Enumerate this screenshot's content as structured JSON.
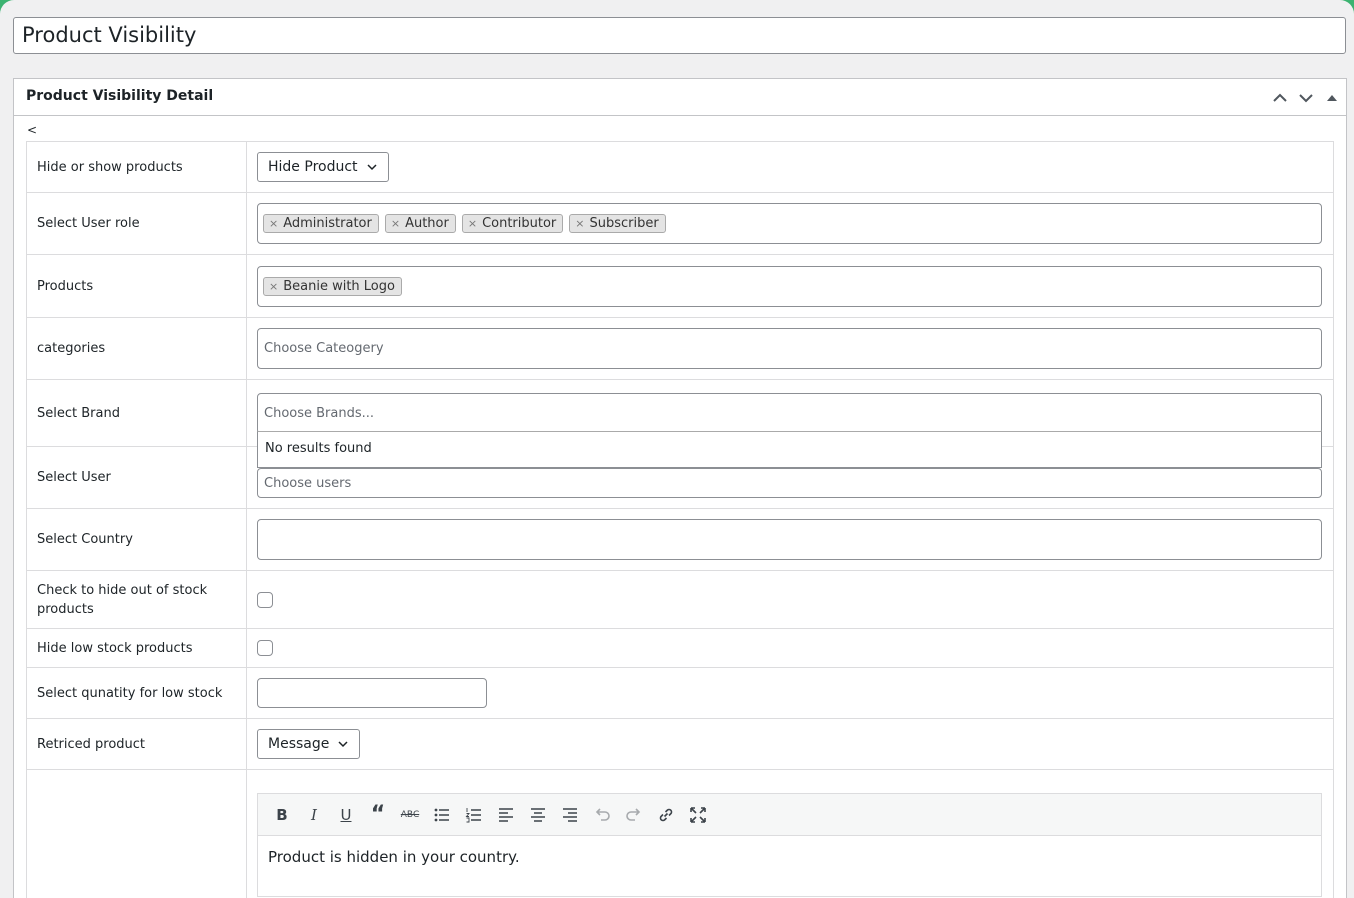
{
  "page": {
    "title": "Product Visibility"
  },
  "box": {
    "title": "Product Visibility Detail",
    "stray_text": "<"
  },
  "rows": {
    "hide_show": {
      "label": "Hide or show products",
      "value": "Hide Product"
    },
    "user_role": {
      "label": "Select User role",
      "chips": [
        "Administrator",
        "Author",
        "Contributor",
        "Subscriber"
      ]
    },
    "products": {
      "label": "Products",
      "chips": [
        "Beanie with Logo"
      ]
    },
    "categories": {
      "label": "categories",
      "placeholder": "Choose Cateogery"
    },
    "brand": {
      "label": "Select Brand",
      "placeholder": "Choose Brands...",
      "dropdown_text": "No results found"
    },
    "user": {
      "label": "Select User",
      "placeholder": "Choose users"
    },
    "country": {
      "label": "Select Country",
      "value": ""
    },
    "out_of_stock": {
      "label": "Check to hide out of stock products",
      "checked": false
    },
    "low_stock": {
      "label": "Hide low stock products",
      "checked": false
    },
    "low_stock_qty": {
      "label": "Select qunatity for low stock",
      "value": ""
    },
    "restricted": {
      "label": "Retriced product",
      "value": "Message"
    }
  },
  "editor": {
    "toolbar": [
      "bold-icon",
      "italic-icon",
      "underline-icon",
      "blockquote-icon",
      "strikethrough-icon",
      "bullet-list-icon",
      "numbered-list-icon",
      "align-left-icon",
      "align-center-icon",
      "align-right-icon",
      "undo-icon",
      "redo-icon",
      "link-icon",
      "fullscreen-icon"
    ],
    "content": "Product is hidden in your country."
  }
}
